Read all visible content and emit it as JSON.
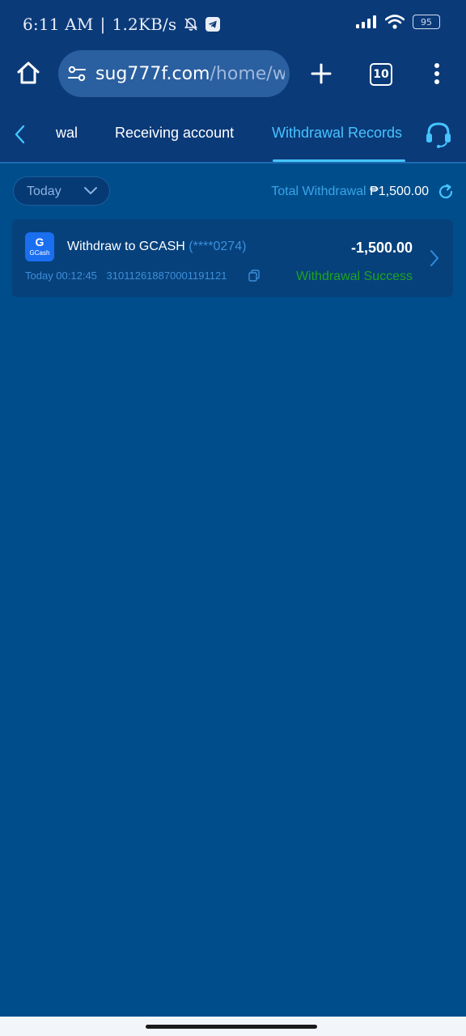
{
  "statusbar": {
    "time": "6:11 AM",
    "separator": "|",
    "speed": "1.2KB/s",
    "battery": "95",
    "icons": [
      "bell-off-icon",
      "telegram-icon",
      "signal-icon",
      "wifi-icon",
      "battery-icon"
    ]
  },
  "browser": {
    "url_domain": "sug777f.com",
    "url_path": "/home/wi",
    "tab_count": "10",
    "icons": [
      "home-icon",
      "site-settings-icon",
      "new-tab-icon",
      "tabs-icon",
      "more-menu-icon"
    ]
  },
  "subnav": {
    "tab_partial": "wal",
    "tab_receiving": "Receiving account",
    "tab_records": "Withdrawal Records",
    "icons": [
      "back-icon",
      "customer-service-icon"
    ]
  },
  "filter": {
    "selected": "Today",
    "total_label": "Total Withdrawal",
    "total_amount": "₱1,500.00"
  },
  "records": [
    {
      "title": "Withdraw to GCASH",
      "masked_account": "(****0274)",
      "amount": "-1,500.00",
      "date": "Today 00:12:45",
      "order_id": "310112618870001191121",
      "status": "Withdrawal Success",
      "logo_letter": "G",
      "logo_text": "GCash"
    }
  ],
  "colors": {
    "background": "#004d8c",
    "header": "#0b3a79",
    "accent": "#45c4ff",
    "success": "#1ea51e"
  }
}
